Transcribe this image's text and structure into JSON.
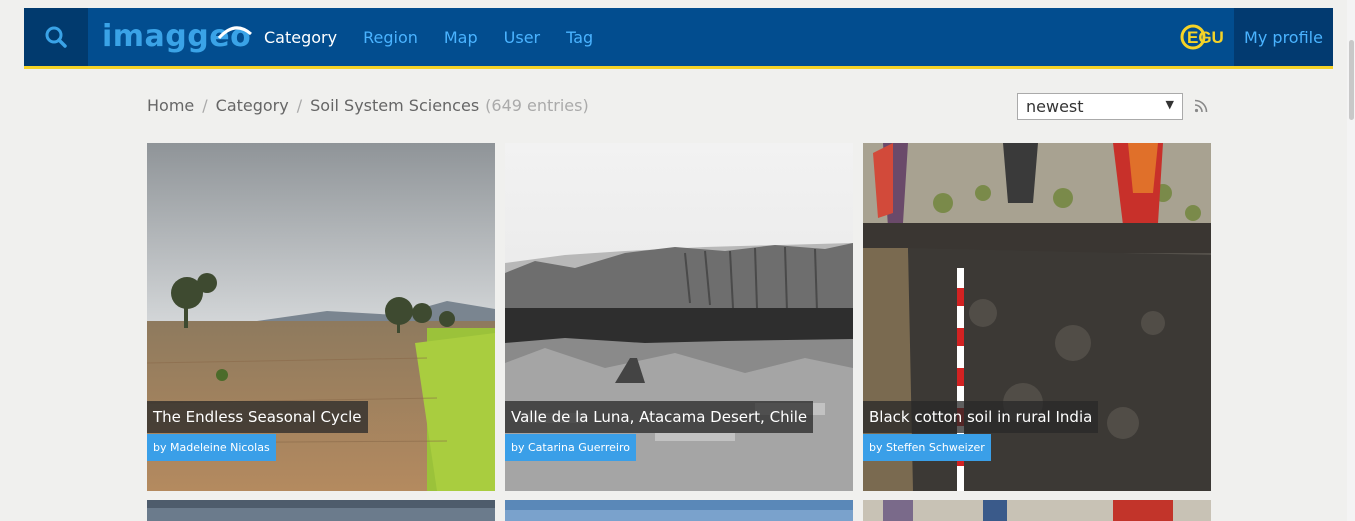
{
  "header": {
    "logo_text": "imaggeo",
    "nav": [
      {
        "label": "Category",
        "active": true
      },
      {
        "label": "Region",
        "active": false
      },
      {
        "label": "Map",
        "active": false
      },
      {
        "label": "User",
        "active": false
      },
      {
        "label": "Tag",
        "active": false
      }
    ],
    "egu_text": "EGU",
    "profile_label": "My profile"
  },
  "breadcrumb": {
    "home": "Home",
    "category": "Category",
    "current": "Soil System Sciences",
    "count": "(649 entries)"
  },
  "sort": {
    "selected": "newest"
  },
  "colors": {
    "header_bg": "#024d8f",
    "accent_yellow": "#f5d327",
    "link_blue": "#4ab3ff",
    "author_badge": "#3a9fe8"
  },
  "icons": [
    "search-icon",
    "rss-icon",
    "chevron-down-icon"
  ],
  "cards": [
    {
      "title": "The Endless Seasonal Cycle",
      "author": "by Madeleine Nicolas"
    },
    {
      "title": "Valle de la Luna, Atacama Desert, Chile",
      "author": "by Catarina Guerreiro"
    },
    {
      "title": "Black cotton soil in rural India",
      "author": "by Steffen Schweizer"
    }
  ]
}
